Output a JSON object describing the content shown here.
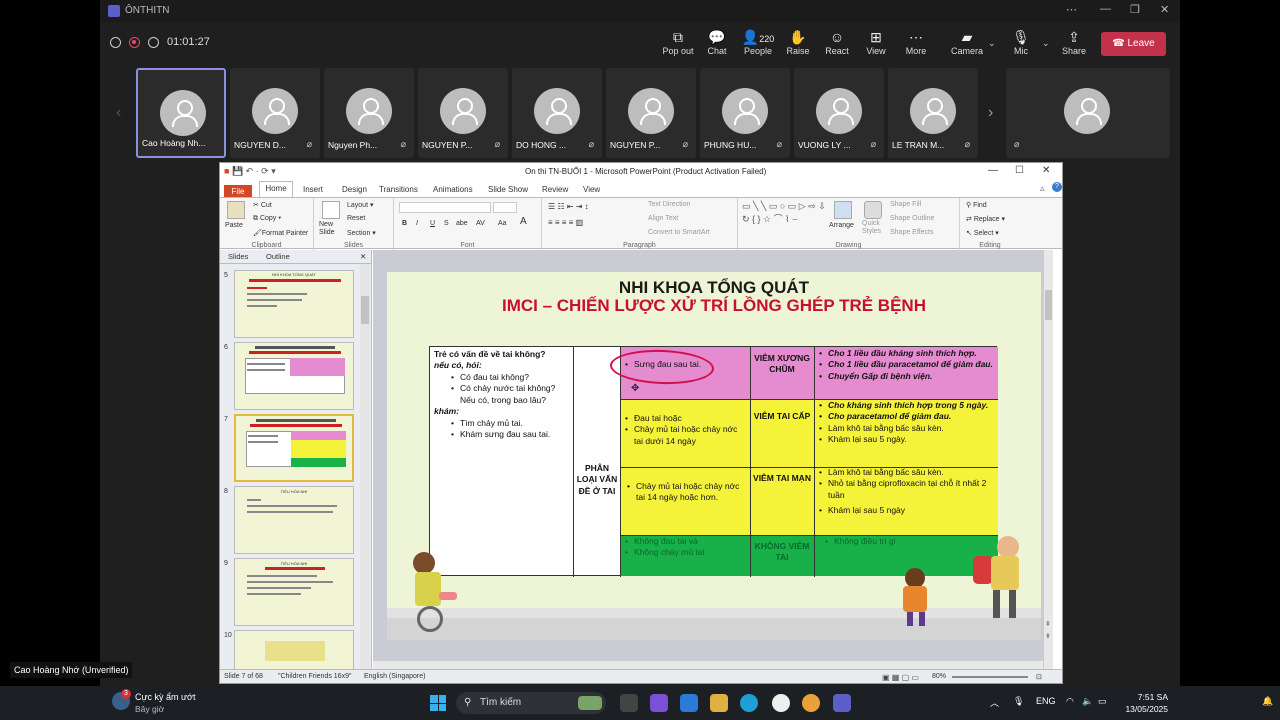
{
  "teams": {
    "window_title": "ÔNTHITN",
    "timer": "01:01:27",
    "toolbar": [
      {
        "label": "Pop out",
        "icon": "pop-out-icon",
        "count": ""
      },
      {
        "label": "Chat",
        "icon": "chat-icon",
        "count": ""
      },
      {
        "label": "People",
        "icon": "people-icon",
        "count": "220"
      },
      {
        "label": "Raise",
        "icon": "hand-icon",
        "count": ""
      },
      {
        "label": "React",
        "icon": "smile-icon",
        "count": ""
      },
      {
        "label": "View",
        "icon": "grid-icon",
        "count": ""
      },
      {
        "label": "More",
        "icon": "more-icon",
        "count": ""
      },
      {
        "label": "Camera",
        "icon": "camera-off-icon",
        "count": ""
      },
      {
        "label": "Mic",
        "icon": "mic-off-icon",
        "count": ""
      },
      {
        "label": "Share",
        "icon": "share-icon",
        "count": ""
      }
    ],
    "leave_label": "Leave",
    "participants": [
      {
        "name": "Cao Hoàng Nh..."
      },
      {
        "name": "NGUYEN D..."
      },
      {
        "name": "Nguyen Ph..."
      },
      {
        "name": "NGUYEN P..."
      },
      {
        "name": "DO HONG ..."
      },
      {
        "name": "NGUYEN P..."
      },
      {
        "name": "PHUNG HU..."
      },
      {
        "name": "VUONG LY ..."
      },
      {
        "name": "LE TRAN M..."
      },
      {
        "name": ""
      }
    ],
    "hover_label": "Cao Hoàng Nhớ (Unverified)"
  },
  "ppt": {
    "title": "On thi TN-BUỔI 1  -  Microsoft PowerPoint (Product Activation Failed)",
    "tabs": [
      "File",
      "Home",
      "Insert",
      "Design",
      "Transitions",
      "Animations",
      "Slide Show",
      "Review",
      "View"
    ],
    "ribbon": {
      "clipboard": {
        "paste": "Paste",
        "cut": "Cut",
        "copy": "Copy",
        "format_painter": "Format Painter",
        "group": "Clipboard"
      },
      "slides": {
        "new_slide": "New Slide",
        "layout": "Layout",
        "reset": "Reset",
        "section": "Section",
        "group": "Slides"
      },
      "font": {
        "group": "Font",
        "bold": "B",
        "italic": "I",
        "underline": "U",
        "strike": "S",
        "shadow": "abe",
        "spacing": "AV",
        "case": "Aa"
      },
      "paragraph": {
        "text_direction": "Text Direction",
        "align_text": "Align Text",
        "convert_smartart": "Convert to SmartArt",
        "group": "Paragraph"
      },
      "drawing": {
        "arrange": "Arrange",
        "quick_styles": "Quick Styles",
        "shape_fill": "Shape Fill",
        "shape_outline": "Shape Outline",
        "shape_effects": "Shape Effects",
        "group": "Drawing"
      },
      "editing": {
        "find": "Find",
        "replace": "Replace",
        "select": "Select",
        "group": "Editing"
      }
    },
    "pane_tabs": [
      "Slides",
      "Outline"
    ],
    "thumbs": [
      {
        "num": "5"
      },
      {
        "num": "6"
      },
      {
        "num": "7"
      },
      {
        "num": "8"
      },
      {
        "num": "9"
      },
      {
        "num": "10"
      }
    ],
    "thumb_texts": {
      "slide5_title": "NHI KHOA TỔNG QUÁT",
      "slide8_title": "TIÊU HÓA NHI",
      "slide9_title": "TIÊU HÓA NHI"
    },
    "status": {
      "slide": "Slide 7 of 68",
      "theme": "\"Children Friends 16x9\"",
      "lang": "English (Singapore)",
      "zoom": "80%"
    }
  },
  "slide": {
    "title1": "NHI KHOA TỔNG QUÁT",
    "title2": "IMCI – CHIẾN LƯỢC XỬ TRÍ LỒNG GHÉP TRẺ BỆNH",
    "colors": {
      "pink": "#e58bcf",
      "yellow": "#f5f23a",
      "green": "#17b049"
    },
    "left_col": {
      "q": "Trẻ có vấn đề về tai không?",
      "ask": "nếu có, hỏi:",
      "items": [
        "Có đau tai không?",
        "Có chảy nước tai không? Nếu có, trong bao lâu?"
      ],
      "exam": "khám:",
      "exam_items": [
        "Tìm chảy mủ tai.",
        "Khám sưng đau sau tai."
      ]
    },
    "classify": "PHÂN LOẠI VẤN ĐỀ Ở TAI",
    "rows": [
      {
        "signs": [
          "Sưng đau sau tai."
        ],
        "label": "VIÊM XƯƠNG CHŨM",
        "treat": [
          "Cho 1 liều đầu kháng sinh thích hợp.",
          "Cho 1 liều đầu paracetamol để giảm đau.",
          "Chuyển Gấp đi bệnh viện."
        ]
      },
      {
        "signs": [
          "Đau tai hoặc",
          "Chảy mủ tai hoặc chảy  nớc tai dưới 14 ngày"
        ],
        "label": "VIÊM TAI CẤP",
        "treat": [
          "Cho kháng sinh thích hợp trong 5 ngày.",
          "Cho paracetamol để giảm đau.",
          "Làm khô tai bằng bấc sâu kèn.",
          "Khám lại sau 5 ngày."
        ]
      },
      {
        "signs": [
          "Chảy mủ tai hoặc chảy  nớc tai 14 ngày hoặc hơn."
        ],
        "label": "VIÊM TAI MẠN",
        "treat": [
          "Làm khô tai bằng bấc sâu kèn.",
          "Nhỏ tai bằng ciprofloxacin tại chỗ ít nhất 2 tuần",
          "Khám lại sau 5 ngày"
        ]
      },
      {
        "signs": [
          "Không đau tai và",
          "Không chảy mủ tai"
        ],
        "label": "KHÔNG VIÊM TAI",
        "treat": [
          "Không điều trị gì"
        ]
      }
    ]
  },
  "taskbar": {
    "weather_title": "Cực kỳ ẩm ướt",
    "weather_sub": "Bây giờ",
    "weather_badge": "3",
    "search": "Tìm kiếm",
    "lang": "ENG",
    "time": "7:51 SA",
    "date": "13/05/2025"
  }
}
